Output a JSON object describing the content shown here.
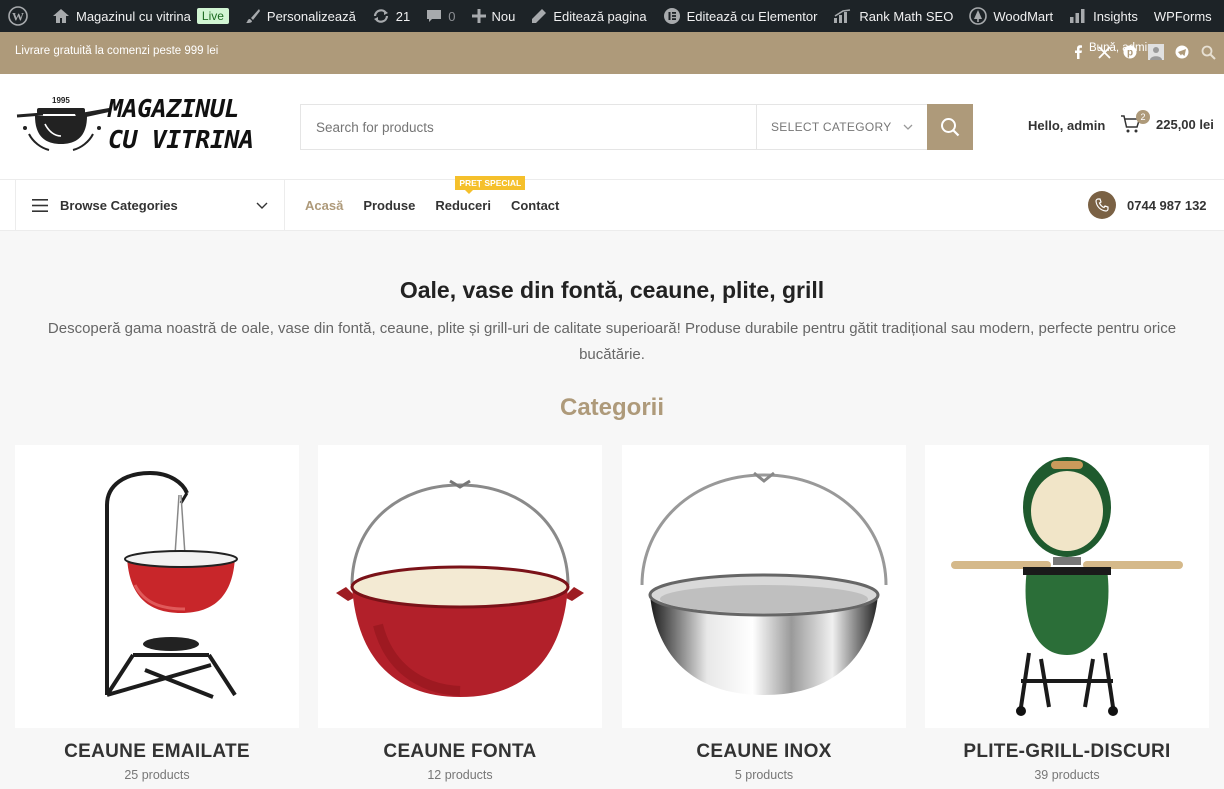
{
  "admin_bar": {
    "site_name": "Magazinul cu vitrina",
    "live_badge": "Live",
    "customize": "Personalizează",
    "updates_count": "21",
    "comments_count": "0",
    "new_label": "Nou",
    "edit_page": "Editează pagina",
    "edit_elementor": "Editează cu Elementor",
    "rank_math": "Rank Math SEO",
    "woodmart": "WoodMart",
    "insights": "Insights",
    "wpforms": "WPForms"
  },
  "promo_bar": {
    "text": "Livrare gratuită la comenzi peste 999 lei",
    "greeting": "Bună, admin"
  },
  "header": {
    "logo_year": "1995",
    "logo_line1": "MAGAZINUL",
    "logo_line2": "CU VITRINA",
    "search_placeholder": "Search for products",
    "select_category": "SELECT CATEGORY",
    "hello": "Hello, admin",
    "cart_count": "2",
    "cart_total": "225,00 lei"
  },
  "nav": {
    "browse_categories": "Browse Categories",
    "items": [
      {
        "label": "Acasă"
      },
      {
        "label": "Produse"
      },
      {
        "label": "Reduceri",
        "badge": "PREȚ SPECIAL"
      },
      {
        "label": "Contact"
      }
    ],
    "phone": "0744 987 132"
  },
  "main": {
    "title": "Oale, vase din fontă, ceaune, plite, grill",
    "description": "Descoperă gama noastră de oale, vase din fontă, ceaune, plite și grill-uri de calitate superioară! Produse durabile pentru gătit tradițional sau modern, perfecte pentru orice bucătărie.",
    "categories_heading": "Categorii",
    "categories": [
      {
        "name": "CEAUNE EMAILATE",
        "count": "25 products"
      },
      {
        "name": "CEAUNE FONTA",
        "count": "12 products"
      },
      {
        "name": "CEAUNE INOX",
        "count": "5 products"
      },
      {
        "name": "PLITE-GRILL-DISCURI",
        "count": "39 products"
      }
    ]
  },
  "colors": {
    "accent": "#ae9a7a",
    "admin_bar": "#1d2327",
    "badge": "#f5c02b"
  }
}
